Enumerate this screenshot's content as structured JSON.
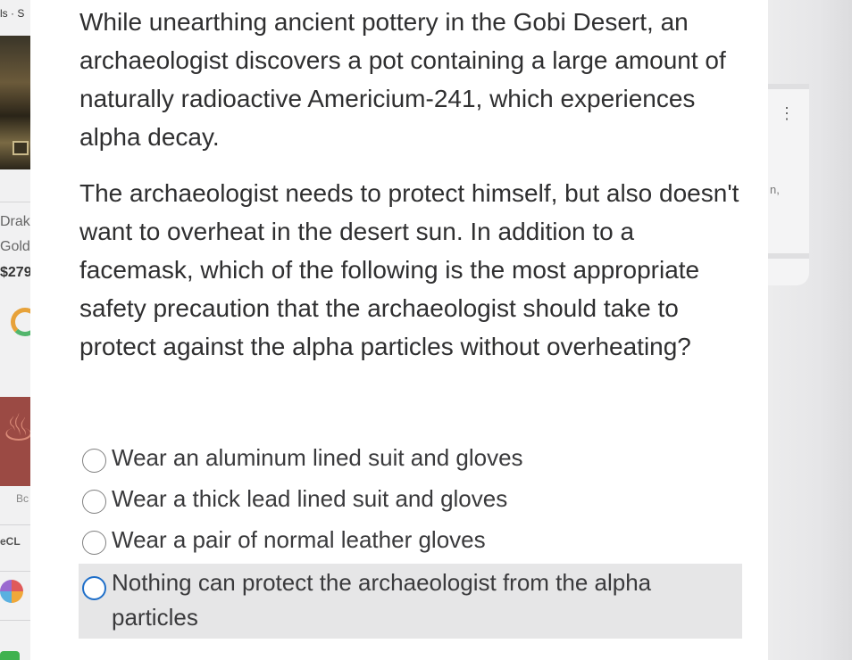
{
  "background": {
    "left": {
      "crumb": "ls · S",
      "product_name": "Drak",
      "product_sub": "Gold",
      "product_price": "$279",
      "label_bc": "Bc",
      "label_ecl": "eCL"
    },
    "right": {
      "kebab": "⋮",
      "fragment": "n,"
    }
  },
  "question": {
    "paragraph1": "While unearthing ancient pottery in the Gobi Desert, an archaeologist discovers a pot containing a large amount of naturally radioactive Americium-241, which experiences alpha decay.",
    "paragraph2": "The archaeologist needs to protect himself, but also doesn't want to overheat in the desert sun. In addition to a facemask, which of the following is the most appropriate safety precaution that the archaeologist should take to protect against the alpha particles without overheating?"
  },
  "options": [
    {
      "label": "Wear an aluminum lined suit and gloves",
      "selected": false
    },
    {
      "label": "Wear a thick lead lined suit and gloves",
      "selected": false
    },
    {
      "label": "Wear a pair of normal leather gloves",
      "selected": false
    },
    {
      "label": "Nothing can protect the archaeologist from the alpha particles",
      "selected": true
    }
  ],
  "colors": {
    "selected_radio": "#1f6fc9",
    "selected_background": "#e6e6e7",
    "text": "#2f2f30"
  }
}
